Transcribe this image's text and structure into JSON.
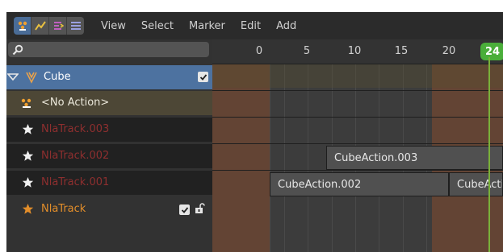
{
  "header": {
    "mode_icons": [
      "nla-editor-icon",
      "graph-editor-icon",
      "drivers-icon",
      "dope-sheet-icon"
    ],
    "menu": [
      "View",
      "Select",
      "Marker",
      "Edit",
      "Add"
    ]
  },
  "left_panel": {
    "object": {
      "label": "Cube",
      "checked": true
    },
    "action": {
      "label": "<No Action>"
    },
    "tracks": [
      {
        "label": "NlaTrack.003"
      },
      {
        "label": "NlaTrack.002"
      },
      {
        "label": "NlaTrack.001"
      },
      {
        "label": "NlaTrack"
      }
    ]
  },
  "timeline": {
    "ticks": [
      "0",
      "5",
      "10",
      "15",
      "20"
    ],
    "current_frame": "24",
    "strips": [
      {
        "label": "CubeAction.003"
      },
      {
        "label": "CubeAction.002"
      },
      {
        "label": "CubeActi"
      }
    ]
  },
  "colors": {
    "selected_row": "#4d72a0",
    "frame_badge": "#4aae3a",
    "out_of_range": "#6a4532",
    "active_track": "#e38e2a",
    "muted_track": "#8e2f2f"
  }
}
